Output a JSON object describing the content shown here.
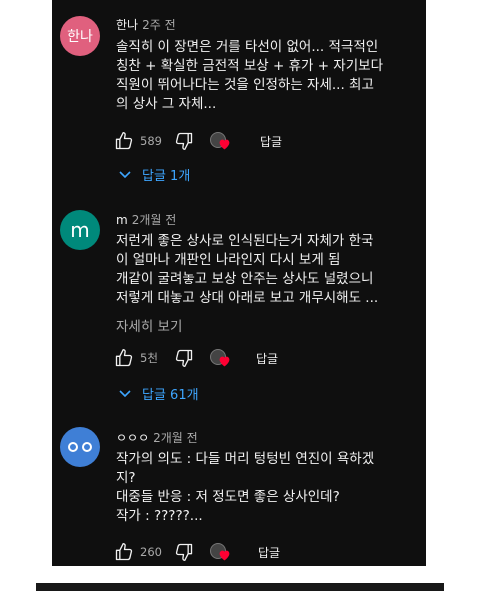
{
  "comments": [
    {
      "avatar_text": "한나",
      "author": "한나",
      "time": "2주 전",
      "lines": [
        "솔직히 이 장면은 거를 타선이 없어... 적극적인",
        "칭찬 + 확실한 금전적 보상 + 휴가 + 자기보다",
        "직원이 뛰어나다는 것을 인정하는 자세... 최고",
        "의 상사 그 자체..."
      ],
      "likes": "589",
      "reply_label": "답글",
      "replies": "답글 1개",
      "avatar_color": "#e0607e"
    },
    {
      "avatar_text": "m",
      "author": "m",
      "time": "2개월 전",
      "lines": [
        "저런게 좋은 상사로 인식된다는거 자체가 한국",
        "이 얼마나 개판인 나라인지 다시 보게 됨",
        "개같이 굴려놓고 보상 안주는 상사도 널렸으니",
        "저렇게 대놓고 상대 아래로 보고 개무시해도 ..."
      ],
      "more": "자세히 보기",
      "likes": "5천",
      "reply_label": "답글",
      "replies": "답글 61개",
      "avatar_color": "#00897b"
    },
    {
      "avatar_text": "",
      "author": "ㅇㅇㅇ",
      "time": "2개월 전",
      "lines": [
        "작가의 의도 : 다들 머리 텅텅빈 연진이 욕하겠",
        "지?",
        "대중들 반응 : 저 정도면 좋은 상사인데?",
        "작가 : ?????..."
      ],
      "likes": "260",
      "reply_label": "답글",
      "avatar_color": "#3f7fd6"
    }
  ]
}
